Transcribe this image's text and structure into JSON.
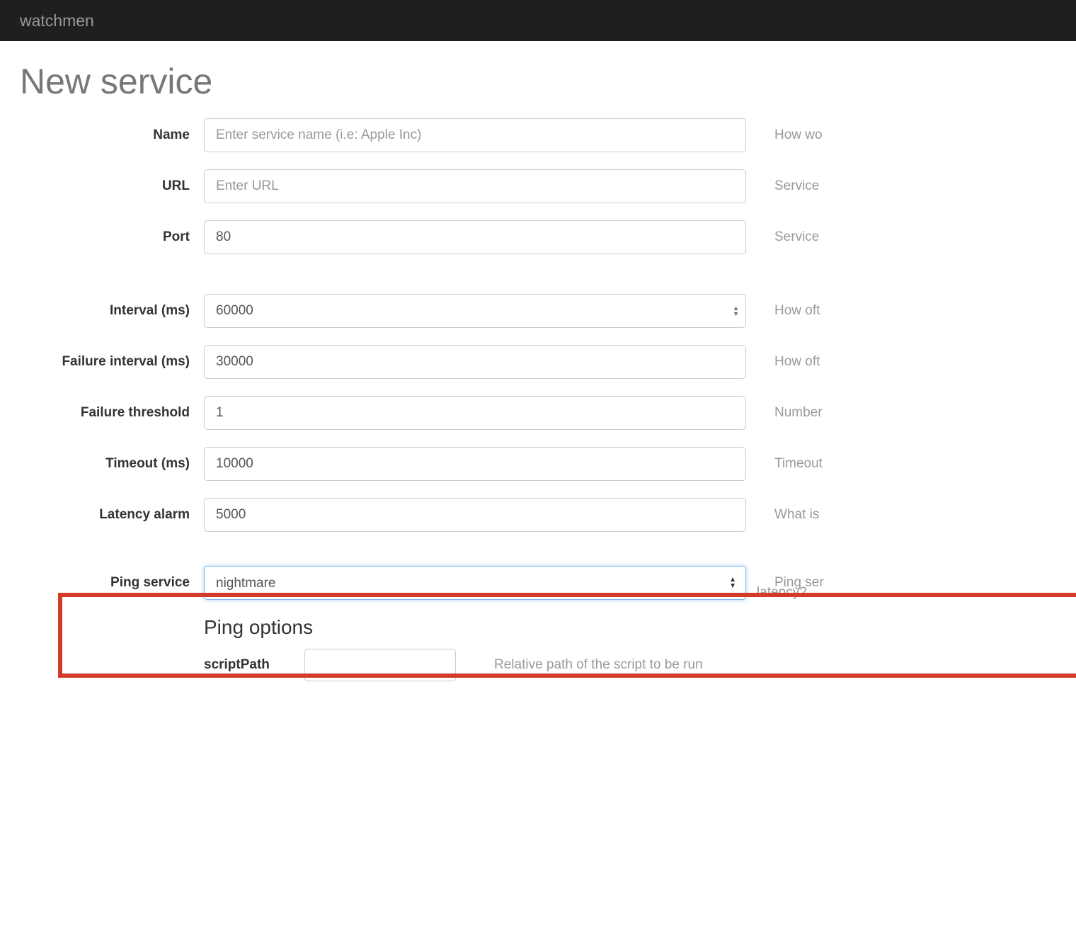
{
  "navbar": {
    "brand": "watchmen"
  },
  "page": {
    "title": "New service"
  },
  "fields": {
    "name": {
      "label": "Name",
      "placeholder": "Enter service name (i.e: Apple Inc)",
      "help": "How wo"
    },
    "url": {
      "label": "URL",
      "placeholder": "Enter URL",
      "help": "Service"
    },
    "port": {
      "label": "Port",
      "value": "80",
      "help": "Service"
    },
    "interval": {
      "label": "Interval (ms)",
      "value": "60000",
      "help": "How oft"
    },
    "failureInterval": {
      "label": "Failure interval (ms)",
      "value": "30000",
      "help": "How oft"
    },
    "failureThreshold": {
      "label": "Failure threshold",
      "value": "1",
      "help": "Number"
    },
    "timeout": {
      "label": "Timeout (ms)",
      "value": "10000",
      "help": "Timeout"
    },
    "latency": {
      "label": "Latency alarm",
      "value": "5000",
      "help": "What is",
      "help2": "latency?"
    },
    "ping": {
      "label": "Ping service",
      "selected": "nightmare",
      "help": "Ping ser"
    }
  },
  "pingOptions": {
    "title": "Ping options",
    "scriptPath": {
      "label": "scriptPath",
      "help": "Relative path of the script to be run"
    }
  }
}
